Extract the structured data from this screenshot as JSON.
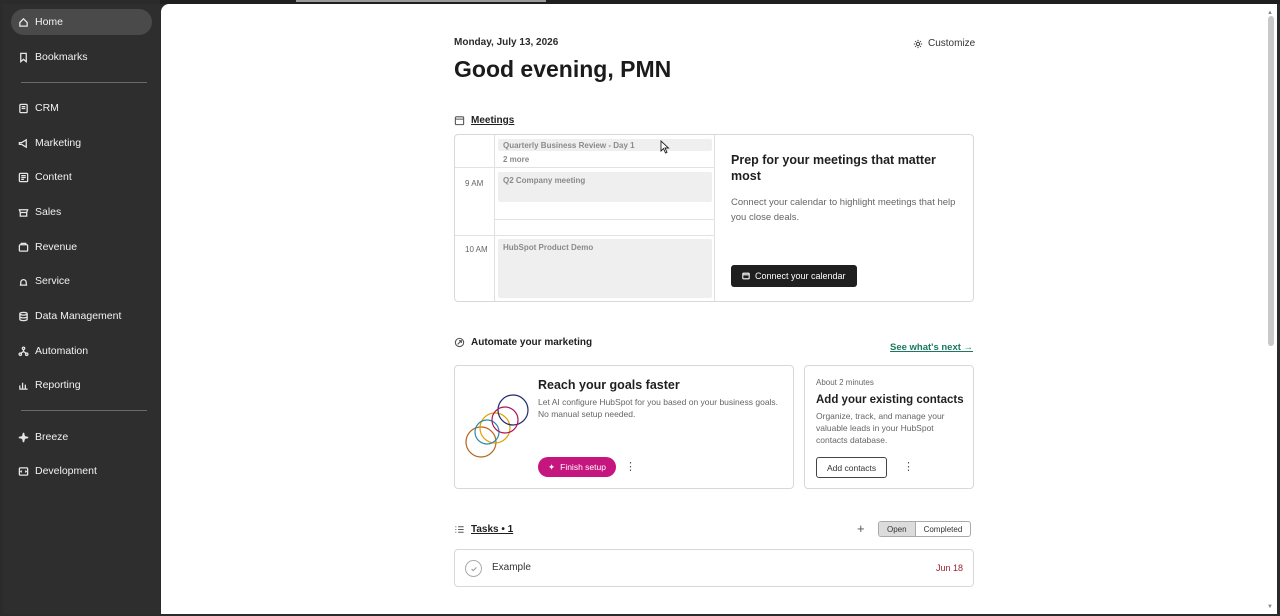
{
  "sidebar": {
    "items": [
      {
        "label": "Home",
        "icon": "home-icon"
      },
      {
        "label": "Bookmarks",
        "icon": "bookmark-icon"
      },
      {
        "label": "CRM",
        "icon": "crm-icon"
      },
      {
        "label": "Marketing",
        "icon": "megaphone-icon"
      },
      {
        "label": "Content",
        "icon": "content-icon"
      },
      {
        "label": "Sales",
        "icon": "sales-icon"
      },
      {
        "label": "Revenue",
        "icon": "revenue-icon"
      },
      {
        "label": "Service",
        "icon": "service-icon"
      },
      {
        "label": "Data Management",
        "icon": "database-icon"
      },
      {
        "label": "Automation",
        "icon": "automation-icon"
      },
      {
        "label": "Reporting",
        "icon": "reporting-icon"
      },
      {
        "label": "Breeze",
        "icon": "sparkle-icon"
      },
      {
        "label": "Development",
        "icon": "development-icon"
      }
    ]
  },
  "header": {
    "date": "Monday, July 13, 2026",
    "greeting": "Good evening, PMN",
    "customize_label": "Customize"
  },
  "meetings": {
    "title": "Meetings",
    "times": [
      "9 AM",
      "10 AM"
    ],
    "events": [
      "Quarterly Business Review - Day 1",
      "Q2 Company meeting",
      "HubSpot Product Demo"
    ],
    "more_label": "2 more",
    "prep_title": "Prep for your meetings that matter most",
    "prep_text": "Connect your calendar to highlight meetings that help you close deals.",
    "connect_label": "Connect your calendar"
  },
  "automate": {
    "title": "Automate your marketing",
    "see_next": "See what's next →",
    "goals": {
      "title": "Reach your goals faster",
      "text": "Let AI configure HubSpot for you based on your business goals. No manual setup needed.",
      "button": "Finish setup"
    },
    "contacts": {
      "meta": "About 2 minutes",
      "title": "Add your existing contacts",
      "text": "Organize, track, and manage your valuable leads in your HubSpot contacts database.",
      "button": "Add contacts"
    }
  },
  "tasks": {
    "title": "Tasks • 1",
    "filters": [
      "Open",
      "Completed"
    ],
    "items": [
      {
        "name": "Example",
        "due": "Jun 18"
      }
    ]
  },
  "colors": {
    "accent_pink": "#c5157e",
    "link_green": "#1a7a5e",
    "due_red": "#9a2230"
  }
}
